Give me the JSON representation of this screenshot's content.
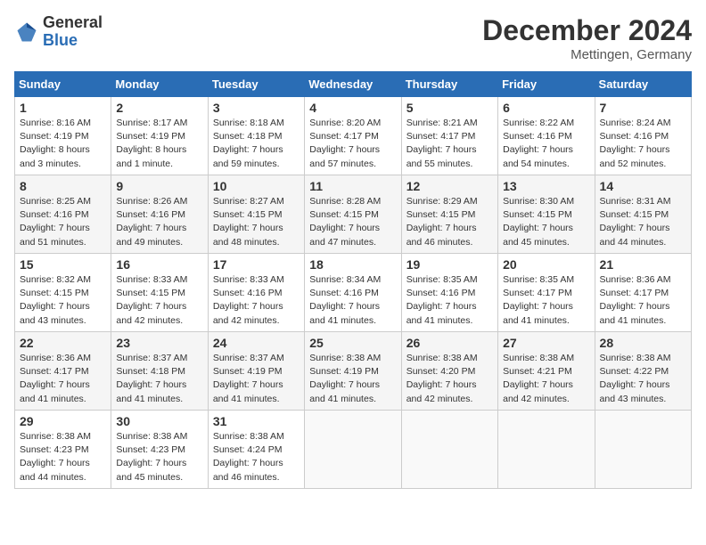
{
  "logo": {
    "general": "General",
    "blue": "Blue"
  },
  "title": {
    "month_year": "December 2024",
    "location": "Mettingen, Germany"
  },
  "calendar": {
    "headers": [
      "Sunday",
      "Monday",
      "Tuesday",
      "Wednesday",
      "Thursday",
      "Friday",
      "Saturday"
    ],
    "weeks": [
      [
        {
          "day": "1",
          "sunrise": "8:16 AM",
          "sunset": "4:19 PM",
          "daylight": "8 hours and 3 minutes."
        },
        {
          "day": "2",
          "sunrise": "8:17 AM",
          "sunset": "4:19 PM",
          "daylight": "8 hours and 1 minute."
        },
        {
          "day": "3",
          "sunrise": "8:18 AM",
          "sunset": "4:18 PM",
          "daylight": "7 hours and 59 minutes."
        },
        {
          "day": "4",
          "sunrise": "8:20 AM",
          "sunset": "4:17 PM",
          "daylight": "7 hours and 57 minutes."
        },
        {
          "day": "5",
          "sunrise": "8:21 AM",
          "sunset": "4:17 PM",
          "daylight": "7 hours and 55 minutes."
        },
        {
          "day": "6",
          "sunrise": "8:22 AM",
          "sunset": "4:16 PM",
          "daylight": "7 hours and 54 minutes."
        },
        {
          "day": "7",
          "sunrise": "8:24 AM",
          "sunset": "4:16 PM",
          "daylight": "7 hours and 52 minutes."
        }
      ],
      [
        {
          "day": "8",
          "sunrise": "8:25 AM",
          "sunset": "4:16 PM",
          "daylight": "7 hours and 51 minutes."
        },
        {
          "day": "9",
          "sunrise": "8:26 AM",
          "sunset": "4:16 PM",
          "daylight": "7 hours and 49 minutes."
        },
        {
          "day": "10",
          "sunrise": "8:27 AM",
          "sunset": "4:15 PM",
          "daylight": "7 hours and 48 minutes."
        },
        {
          "day": "11",
          "sunrise": "8:28 AM",
          "sunset": "4:15 PM",
          "daylight": "7 hours and 47 minutes."
        },
        {
          "day": "12",
          "sunrise": "8:29 AM",
          "sunset": "4:15 PM",
          "daylight": "7 hours and 46 minutes."
        },
        {
          "day": "13",
          "sunrise": "8:30 AM",
          "sunset": "4:15 PM",
          "daylight": "7 hours and 45 minutes."
        },
        {
          "day": "14",
          "sunrise": "8:31 AM",
          "sunset": "4:15 PM",
          "daylight": "7 hours and 44 minutes."
        }
      ],
      [
        {
          "day": "15",
          "sunrise": "8:32 AM",
          "sunset": "4:15 PM",
          "daylight": "7 hours and 43 minutes."
        },
        {
          "day": "16",
          "sunrise": "8:33 AM",
          "sunset": "4:15 PM",
          "daylight": "7 hours and 42 minutes."
        },
        {
          "day": "17",
          "sunrise": "8:33 AM",
          "sunset": "4:16 PM",
          "daylight": "7 hours and 42 minutes."
        },
        {
          "day": "18",
          "sunrise": "8:34 AM",
          "sunset": "4:16 PM",
          "daylight": "7 hours and 41 minutes."
        },
        {
          "day": "19",
          "sunrise": "8:35 AM",
          "sunset": "4:16 PM",
          "daylight": "7 hours and 41 minutes."
        },
        {
          "day": "20",
          "sunrise": "8:35 AM",
          "sunset": "4:17 PM",
          "daylight": "7 hours and 41 minutes."
        },
        {
          "day": "21",
          "sunrise": "8:36 AM",
          "sunset": "4:17 PM",
          "daylight": "7 hours and 41 minutes."
        }
      ],
      [
        {
          "day": "22",
          "sunrise": "8:36 AM",
          "sunset": "4:17 PM",
          "daylight": "7 hours and 41 minutes."
        },
        {
          "day": "23",
          "sunrise": "8:37 AM",
          "sunset": "4:18 PM",
          "daylight": "7 hours and 41 minutes."
        },
        {
          "day": "24",
          "sunrise": "8:37 AM",
          "sunset": "4:19 PM",
          "daylight": "7 hours and 41 minutes."
        },
        {
          "day": "25",
          "sunrise": "8:38 AM",
          "sunset": "4:19 PM",
          "daylight": "7 hours and 41 minutes."
        },
        {
          "day": "26",
          "sunrise": "8:38 AM",
          "sunset": "4:20 PM",
          "daylight": "7 hours and 42 minutes."
        },
        {
          "day": "27",
          "sunrise": "8:38 AM",
          "sunset": "4:21 PM",
          "daylight": "7 hours and 42 minutes."
        },
        {
          "day": "28",
          "sunrise": "8:38 AM",
          "sunset": "4:22 PM",
          "daylight": "7 hours and 43 minutes."
        }
      ],
      [
        {
          "day": "29",
          "sunrise": "8:38 AM",
          "sunset": "4:23 PM",
          "daylight": "7 hours and 44 minutes."
        },
        {
          "day": "30",
          "sunrise": "8:38 AM",
          "sunset": "4:23 PM",
          "daylight": "7 hours and 45 minutes."
        },
        {
          "day": "31",
          "sunrise": "8:38 AM",
          "sunset": "4:24 PM",
          "daylight": "7 hours and 46 minutes."
        },
        null,
        null,
        null,
        null
      ]
    ]
  }
}
